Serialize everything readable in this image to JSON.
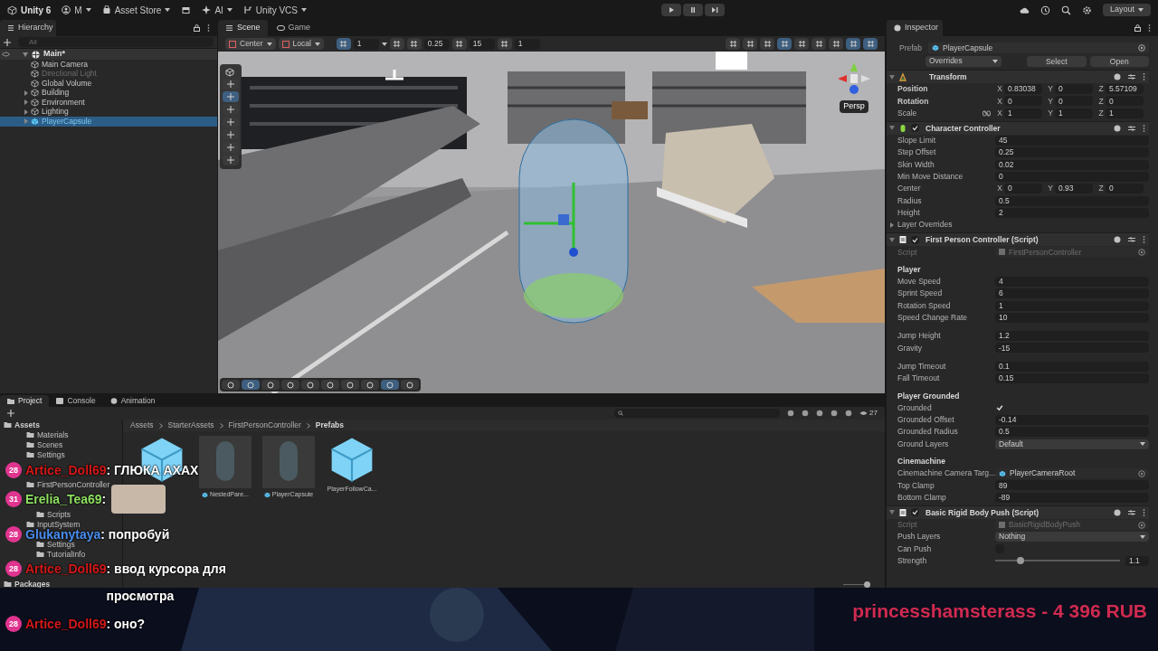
{
  "top_bar": {
    "title": "Unity 6",
    "account": "M",
    "menus": [
      "Asset Store",
      "AI",
      "Unity VCS"
    ],
    "layout": "Layout"
  },
  "hierarchy": {
    "title": "Hierarchy",
    "search_placeholder": "All",
    "scene": "Main*",
    "items": [
      {
        "label": "Main Camera",
        "expandable": false,
        "disabled": false,
        "selected": false,
        "prefab": false
      },
      {
        "label": "Directional Light",
        "expandable": false,
        "disabled": true,
        "selected": false,
        "prefab": false
      },
      {
        "label": "Global Volume",
        "expandable": false,
        "disabled": false,
        "selected": false,
        "prefab": false
      },
      {
        "label": "Building",
        "expandable": true,
        "disabled": false,
        "selected": false,
        "prefab": false
      },
      {
        "label": "Environment",
        "expandable": true,
        "disabled": false,
        "selected": false,
        "prefab": false
      },
      {
        "label": "Lighting",
        "expandable": true,
        "disabled": false,
        "selected": false,
        "prefab": false
      },
      {
        "label": "PlayerCapsule",
        "expandable": true,
        "disabled": false,
        "selected": true,
        "prefab": true
      }
    ]
  },
  "scene": {
    "tabs": [
      {
        "label": "Scene",
        "selected": true
      },
      {
        "label": "Game",
        "selected": false
      }
    ],
    "toolbar": {
      "pivot": "Center",
      "space": "Local",
      "grid": "1",
      "move_snap": "0.25",
      "angle_snap": "15",
      "scale_snap": "1"
    },
    "persp_label": "Persp"
  },
  "inspector": {
    "title": "Inspector",
    "prefab": {
      "label": "Prefab",
      "value": "PlayerCapsule",
      "overrides": "Overrides",
      "buttons": [
        "Select",
        "Open"
      ]
    },
    "components": [
      {
        "title": "Transform",
        "kind": "transform",
        "rows": [
          {
            "kind": "vector",
            "label": "Position",
            "axes": [
              {
                "axis": "X",
                "value": "0.83038"
              },
              {
                "axis": "Y",
                "value": "0"
              },
              {
                "axis": "Z",
                "value": "5.57109"
              }
            ]
          },
          {
            "kind": "vector",
            "label": "Rotation",
            "axes": [
              {
                "axis": "X",
                "value": "0"
              },
              {
                "axis": "Y",
                "value": "0"
              },
              {
                "axis": "Z",
                "value": "0"
              }
            ]
          },
          {
            "kind": "vector",
            "label": "Scale",
            "constrain_proportions": false,
            "axes": [
              {
                "axis": "X",
                "value": "1"
              },
              {
                "axis": "Y",
                "value": "1"
              },
              {
                "axis": "Z",
                "value": "1"
              }
            ]
          }
        ]
      },
      {
        "title": "Character Controller",
        "kind": "character",
        "enabled": true,
        "rows": [
          {
            "kind": "field",
            "label": "Slope Limit",
            "value": "45"
          },
          {
            "kind": "field",
            "label": "Step Offset",
            "value": "0.25"
          },
          {
            "kind": "field",
            "label": "Skin Width",
            "value": "0.02"
          },
          {
            "kind": "field",
            "label": "Min Move Distance",
            "value": "0"
          },
          {
            "kind": "vector",
            "label": "Center",
            "axes": [
              {
                "axis": "X",
                "value": "0"
              },
              {
                "axis": "Y",
                "value": "0.93"
              },
              {
                "axis": "Z",
                "value": "0"
              }
            ]
          },
          {
            "kind": "field",
            "label": "Radius",
            "value": "0.5"
          },
          {
            "kind": "field",
            "label": "Height",
            "value": "2"
          },
          {
            "kind": "foldout",
            "label": "Layer Overrides"
          }
        ]
      },
      {
        "title": "First Person Controller (Script)",
        "kind": "script",
        "enabled": true,
        "rows": [
          {
            "kind": "object",
            "label": "Script",
            "value": "FirstPersonController",
            "disabled": true
          },
          {
            "kind": "section",
            "label": "Player"
          },
          {
            "kind": "field",
            "label": "Move Speed",
            "value": "4"
          },
          {
            "kind": "field",
            "label": "Sprint Speed",
            "value": "6"
          },
          {
            "kind": "field",
            "label": "Rotation Speed",
            "value": "1"
          },
          {
            "kind": "field",
            "label": "Speed Change Rate",
            "value": "10"
          },
          {
            "kind": "field",
            "label": "Jump Height",
            "value": "1.2",
            "spaced": true
          },
          {
            "kind": "field",
            "label": "Gravity",
            "value": "-15"
          },
          {
            "kind": "field",
            "label": "Jump Timeout",
            "value": "0.1",
            "spaced": true
          },
          {
            "kind": "field",
            "label": "Fall Timeout",
            "value": "0.15"
          },
          {
            "kind": "section",
            "label": "Player Grounded"
          },
          {
            "kind": "check",
            "label": "Grounded",
            "checked": true
          },
          {
            "kind": "field",
            "label": "Grounded Offset",
            "value": "-0.14"
          },
          {
            "kind": "field",
            "label": "Grounded Radius",
            "value": "0.5"
          },
          {
            "kind": "dropdown",
            "label": "Ground Layers",
            "value": "Default"
          },
          {
            "kind": "section",
            "label": "Cinemachine"
          },
          {
            "kind": "object",
            "label": "Cinemachine Camera Targ...",
            "value": "PlayerCameraRoot",
            "disabled": false
          },
          {
            "kind": "field",
            "label": "Top Clamp",
            "value": "89"
          },
          {
            "kind": "field",
            "label": "Bottom Clamp",
            "value": "-89"
          }
        ]
      },
      {
        "title": "Basic Rigid Body Push (Script)",
        "kind": "script",
        "enabled": true,
        "rows": [
          {
            "kind": "object",
            "label": "Script",
            "value": "BasicRigidBodyPush",
            "disabled": true
          },
          {
            "kind": "dropdown",
            "label": "Push Layers",
            "value": "Nothing"
          },
          {
            "kind": "check",
            "label": "Can Push",
            "checked": false
          },
          {
            "kind": "slider",
            "label": "Strength",
            "level": 0.2,
            "reading": "1.1"
          }
        ]
      }
    ]
  },
  "project": {
    "tabs": [
      {
        "label": "Project",
        "selected": true
      },
      {
        "label": "Console",
        "selected": false
      },
      {
        "label": "Animation",
        "selected": false
      }
    ],
    "tree": [
      {
        "kind": "folder",
        "label": "Assets",
        "children": [
          {
            "kind": "folder",
            "label": "Materials"
          },
          {
            "kind": "folder",
            "label": "Scenes"
          },
          {
            "kind": "folder",
            "label": "Settings"
          },
          {
            "kind": "covered"
          },
          {
            "kind": "covered"
          },
          {
            "kind": "folder",
            "label": "FirstPersonController",
            "children": [
              {
                "kind": "covered"
              },
              {
                "kind": "covered"
              },
              {
                "kind": "folder",
                "label": "Scripts"
              }
            ]
          },
          {
            "kind": "folder",
            "label": "InputSystem",
            "children": [
              {
                "kind": "covered"
              },
              {
                "kind": "folder",
                "label": "Settings"
              },
              {
                "kind": "folder",
                "label": "TutorialInfo"
              },
              {
                "kind": "covered"
              },
              {
                "kind": "covered"
              }
            ]
          }
        ]
      },
      {
        "kind": "folder",
        "label": "Packages"
      }
    ],
    "breadcrumb": [
      "Assets",
      "StarterAssets",
      "FirstPersonController",
      "Prefabs"
    ],
    "visible_count": "27",
    "assets": [
      {
        "kind": "cube"
      },
      {
        "kind": "capsule",
        "label": "NestedPare..."
      },
      {
        "kind": "capsule",
        "label": "PlayerCapsule"
      },
      {
        "kind": "cube",
        "label": "PlayerFollowCa..."
      }
    ]
  },
  "chat": [
    {
      "kind": "text",
      "badge": "28",
      "user": "Artice_Doll69",
      "color": "#d41818",
      "text": ": ГЛЮКА АХАХ"
    },
    {
      "kind": "emote",
      "badge": "31",
      "user": "Erelia_Tea69",
      "color": "#8ee060",
      "text": ":"
    },
    {
      "kind": "text",
      "badge": "28",
      "user": "Glukanytaya",
      "color": "#4a8ef0",
      "text": ": попробуй"
    },
    {
      "kind": "text",
      "badge": "28",
      "user": "Artice_Doll69",
      "color": "#d41818",
      "text": ": ввод курсора для просмотра"
    },
    {
      "kind": "text",
      "badge": "28",
      "user": "Artice_Doll69",
      "color": "#d41818",
      "text": ": оно?"
    }
  ],
  "donation": "princesshamsterass - 4 396 RUB"
}
